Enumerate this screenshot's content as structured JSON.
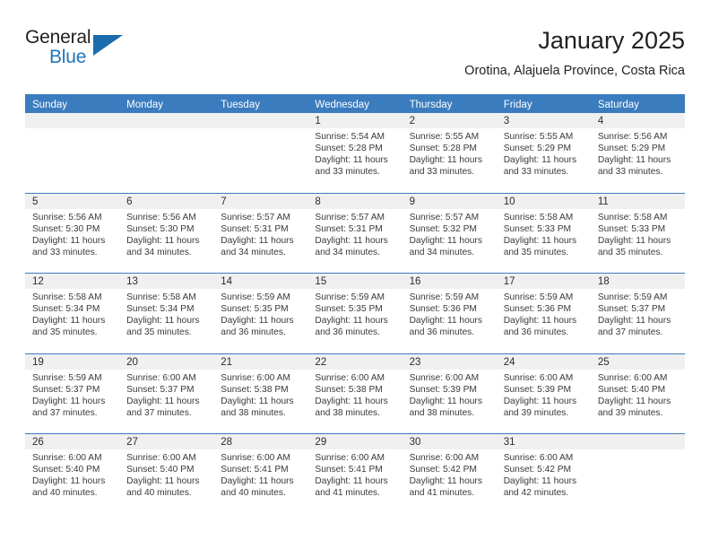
{
  "brand": {
    "word_one": "General",
    "word_two": "Blue",
    "triangle_icon": "triangle-logo-icon",
    "accent_color": "#1b6cad"
  },
  "header": {
    "title": "January 2025",
    "subtitle": "Orotina, Alajuela Province, Costa Rica"
  },
  "calendar": {
    "header_bg": "#3a7cbe",
    "date_band_bg": "#f0f0f0",
    "weekdays": [
      "Sunday",
      "Monday",
      "Tuesday",
      "Wednesday",
      "Thursday",
      "Friday",
      "Saturday"
    ],
    "weeks": [
      [
        {
          "date": "",
          "empty": true
        },
        {
          "date": "",
          "empty": true
        },
        {
          "date": "",
          "empty": true
        },
        {
          "date": "1",
          "sunrise": "Sunrise: 5:54 AM",
          "sunset": "Sunset: 5:28 PM",
          "daylight_l1": "Daylight: 11 hours",
          "daylight_l2": "and 33 minutes."
        },
        {
          "date": "2",
          "sunrise": "Sunrise: 5:55 AM",
          "sunset": "Sunset: 5:28 PM",
          "daylight_l1": "Daylight: 11 hours",
          "daylight_l2": "and 33 minutes."
        },
        {
          "date": "3",
          "sunrise": "Sunrise: 5:55 AM",
          "sunset": "Sunset: 5:29 PM",
          "daylight_l1": "Daylight: 11 hours",
          "daylight_l2": "and 33 minutes."
        },
        {
          "date": "4",
          "sunrise": "Sunrise: 5:56 AM",
          "sunset": "Sunset: 5:29 PM",
          "daylight_l1": "Daylight: 11 hours",
          "daylight_l2": "and 33 minutes."
        }
      ],
      [
        {
          "date": "5",
          "sunrise": "Sunrise: 5:56 AM",
          "sunset": "Sunset: 5:30 PM",
          "daylight_l1": "Daylight: 11 hours",
          "daylight_l2": "and 33 minutes."
        },
        {
          "date": "6",
          "sunrise": "Sunrise: 5:56 AM",
          "sunset": "Sunset: 5:30 PM",
          "daylight_l1": "Daylight: 11 hours",
          "daylight_l2": "and 34 minutes."
        },
        {
          "date": "7",
          "sunrise": "Sunrise: 5:57 AM",
          "sunset": "Sunset: 5:31 PM",
          "daylight_l1": "Daylight: 11 hours",
          "daylight_l2": "and 34 minutes."
        },
        {
          "date": "8",
          "sunrise": "Sunrise: 5:57 AM",
          "sunset": "Sunset: 5:31 PM",
          "daylight_l1": "Daylight: 11 hours",
          "daylight_l2": "and 34 minutes."
        },
        {
          "date": "9",
          "sunrise": "Sunrise: 5:57 AM",
          "sunset": "Sunset: 5:32 PM",
          "daylight_l1": "Daylight: 11 hours",
          "daylight_l2": "and 34 minutes."
        },
        {
          "date": "10",
          "sunrise": "Sunrise: 5:58 AM",
          "sunset": "Sunset: 5:33 PM",
          "daylight_l1": "Daylight: 11 hours",
          "daylight_l2": "and 35 minutes."
        },
        {
          "date": "11",
          "sunrise": "Sunrise: 5:58 AM",
          "sunset": "Sunset: 5:33 PM",
          "daylight_l1": "Daylight: 11 hours",
          "daylight_l2": "and 35 minutes."
        }
      ],
      [
        {
          "date": "12",
          "sunrise": "Sunrise: 5:58 AM",
          "sunset": "Sunset: 5:34 PM",
          "daylight_l1": "Daylight: 11 hours",
          "daylight_l2": "and 35 minutes."
        },
        {
          "date": "13",
          "sunrise": "Sunrise: 5:58 AM",
          "sunset": "Sunset: 5:34 PM",
          "daylight_l1": "Daylight: 11 hours",
          "daylight_l2": "and 35 minutes."
        },
        {
          "date": "14",
          "sunrise": "Sunrise: 5:59 AM",
          "sunset": "Sunset: 5:35 PM",
          "daylight_l1": "Daylight: 11 hours",
          "daylight_l2": "and 36 minutes."
        },
        {
          "date": "15",
          "sunrise": "Sunrise: 5:59 AM",
          "sunset": "Sunset: 5:35 PM",
          "daylight_l1": "Daylight: 11 hours",
          "daylight_l2": "and 36 minutes."
        },
        {
          "date": "16",
          "sunrise": "Sunrise: 5:59 AM",
          "sunset": "Sunset: 5:36 PM",
          "daylight_l1": "Daylight: 11 hours",
          "daylight_l2": "and 36 minutes."
        },
        {
          "date": "17",
          "sunrise": "Sunrise: 5:59 AM",
          "sunset": "Sunset: 5:36 PM",
          "daylight_l1": "Daylight: 11 hours",
          "daylight_l2": "and 36 minutes."
        },
        {
          "date": "18",
          "sunrise": "Sunrise: 5:59 AM",
          "sunset": "Sunset: 5:37 PM",
          "daylight_l1": "Daylight: 11 hours",
          "daylight_l2": "and 37 minutes."
        }
      ],
      [
        {
          "date": "19",
          "sunrise": "Sunrise: 5:59 AM",
          "sunset": "Sunset: 5:37 PM",
          "daylight_l1": "Daylight: 11 hours",
          "daylight_l2": "and 37 minutes."
        },
        {
          "date": "20",
          "sunrise": "Sunrise: 6:00 AM",
          "sunset": "Sunset: 5:37 PM",
          "daylight_l1": "Daylight: 11 hours",
          "daylight_l2": "and 37 minutes."
        },
        {
          "date": "21",
          "sunrise": "Sunrise: 6:00 AM",
          "sunset": "Sunset: 5:38 PM",
          "daylight_l1": "Daylight: 11 hours",
          "daylight_l2": "and 38 minutes."
        },
        {
          "date": "22",
          "sunrise": "Sunrise: 6:00 AM",
          "sunset": "Sunset: 5:38 PM",
          "daylight_l1": "Daylight: 11 hours",
          "daylight_l2": "and 38 minutes."
        },
        {
          "date": "23",
          "sunrise": "Sunrise: 6:00 AM",
          "sunset": "Sunset: 5:39 PM",
          "daylight_l1": "Daylight: 11 hours",
          "daylight_l2": "and 38 minutes."
        },
        {
          "date": "24",
          "sunrise": "Sunrise: 6:00 AM",
          "sunset": "Sunset: 5:39 PM",
          "daylight_l1": "Daylight: 11 hours",
          "daylight_l2": "and 39 minutes."
        },
        {
          "date": "25",
          "sunrise": "Sunrise: 6:00 AM",
          "sunset": "Sunset: 5:40 PM",
          "daylight_l1": "Daylight: 11 hours",
          "daylight_l2": "and 39 minutes."
        }
      ],
      [
        {
          "date": "26",
          "sunrise": "Sunrise: 6:00 AM",
          "sunset": "Sunset: 5:40 PM",
          "daylight_l1": "Daylight: 11 hours",
          "daylight_l2": "and 40 minutes."
        },
        {
          "date": "27",
          "sunrise": "Sunrise: 6:00 AM",
          "sunset": "Sunset: 5:40 PM",
          "daylight_l1": "Daylight: 11 hours",
          "daylight_l2": "and 40 minutes."
        },
        {
          "date": "28",
          "sunrise": "Sunrise: 6:00 AM",
          "sunset": "Sunset: 5:41 PM",
          "daylight_l1": "Daylight: 11 hours",
          "daylight_l2": "and 40 minutes."
        },
        {
          "date": "29",
          "sunrise": "Sunrise: 6:00 AM",
          "sunset": "Sunset: 5:41 PM",
          "daylight_l1": "Daylight: 11 hours",
          "daylight_l2": "and 41 minutes."
        },
        {
          "date": "30",
          "sunrise": "Sunrise: 6:00 AM",
          "sunset": "Sunset: 5:42 PM",
          "daylight_l1": "Daylight: 11 hours",
          "daylight_l2": "and 41 minutes."
        },
        {
          "date": "31",
          "sunrise": "Sunrise: 6:00 AM",
          "sunset": "Sunset: 5:42 PM",
          "daylight_l1": "Daylight: 11 hours",
          "daylight_l2": "and 42 minutes."
        },
        {
          "date": "",
          "empty": true
        }
      ]
    ]
  }
}
